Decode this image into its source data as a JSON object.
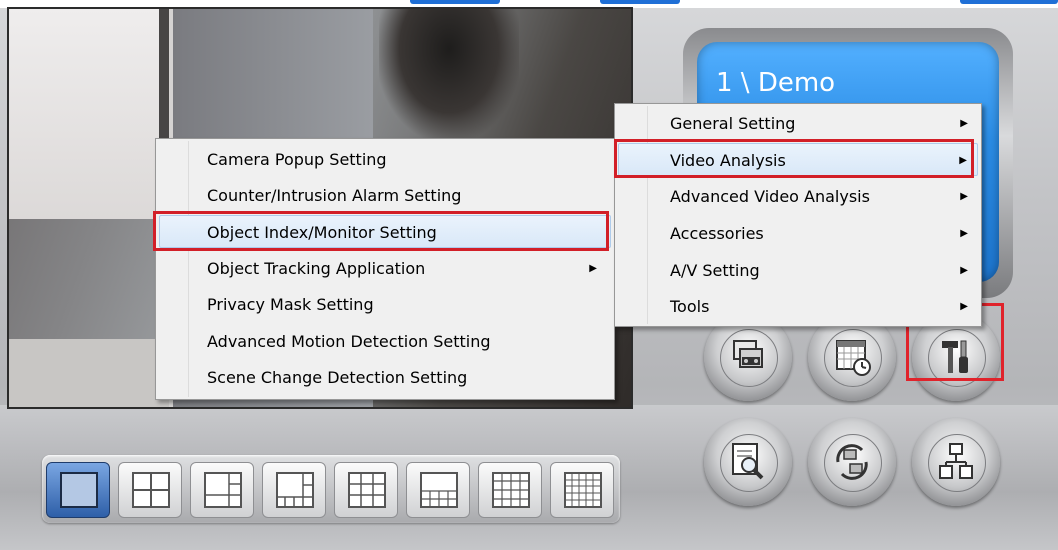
{
  "colors": {
    "highlight": "#d21f28",
    "lcd": "#2b8de6",
    "heading": "#1f6fd6"
  },
  "display": {
    "camera_label": "1 \\ Demo"
  },
  "main_menu": {
    "items": [
      {
        "label": "General Setting",
        "has_submenu": true
      },
      {
        "label": "Video Analysis",
        "has_submenu": true,
        "highlighted": true
      },
      {
        "label": "Advanced Video Analysis",
        "has_submenu": true
      },
      {
        "label": "Accessories",
        "has_submenu": true
      },
      {
        "label": "A/V Setting",
        "has_submenu": true
      },
      {
        "label": "Tools",
        "has_submenu": true
      }
    ],
    "arrow": "▶"
  },
  "video_analysis_menu": {
    "items": [
      {
        "label": "Camera Popup Setting"
      },
      {
        "label": "Counter/Intrusion Alarm Setting"
      },
      {
        "label": "Object Index/Monitor Setting",
        "highlighted": true
      },
      {
        "label": "Object Tracking Application",
        "has_submenu": true
      },
      {
        "label": "Privacy Mask Setting"
      },
      {
        "label": "Advanced Motion Detection Setting"
      },
      {
        "label": "Scene Change Detection Setting"
      }
    ],
    "arrow": "▶"
  },
  "round_buttons": [
    {
      "icon": "dvr-tape-icon"
    },
    {
      "icon": "schedule-calendar-icon"
    },
    {
      "icon": "tools-hammer-screwdriver-icon"
    },
    {
      "icon": "log-search-icon"
    },
    {
      "icon": "backup-sync-icon"
    },
    {
      "icon": "network-icon"
    }
  ],
  "layout_buttons": [
    {
      "icon": "layout-1x1-icon",
      "active": true
    },
    {
      "icon": "layout-2x2-icon"
    },
    {
      "icon": "layout-1plus3-icon"
    },
    {
      "icon": "layout-1plus5-icon"
    },
    {
      "icon": "layout-3x3-icon"
    },
    {
      "icon": "layout-3x4-icon"
    },
    {
      "icon": "layout-4x4-icon"
    },
    {
      "icon": "layout-5x5-icon"
    }
  ]
}
